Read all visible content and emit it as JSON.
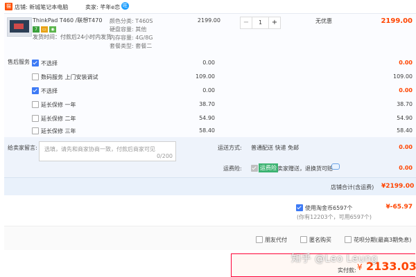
{
  "shop": {
    "icon": "tmall-icon",
    "icon_text": "猫",
    "label": "店铺: 新城笔记本电脑",
    "seller": "卖家: 芊年e恋",
    "ww_icon": "wangwang-icon",
    "ww_text": "旺"
  },
  "item": {
    "title": "ThinkPad T460 /联想T4705...",
    "badges": [
      {
        "text": "7",
        "color": "#3ca13c"
      },
      {
        "text": "▭",
        "color": "#e8a317"
      },
      {
        "text": "◉",
        "color": "#5ab44a"
      }
    ],
    "ship_note": "发货时间：付款后24小时内发货",
    "specs": [
      "颜色分类: T460S",
      "硬盘容量: 其他",
      "内存容量: 4G/8G",
      "套餐类型: 套餐二"
    ],
    "unit_price": "2199.00",
    "qty_minus": "−",
    "qty_value": "1",
    "qty_plus": "+",
    "discount": "无优惠",
    "subtotal": "2199.00"
  },
  "services": {
    "label": "售后服务",
    "rows": [
      {
        "text": "不选择",
        "checked": true,
        "price": "0.00",
        "total": "0.00"
      },
      {
        "text": "数码服务 上门安装调试",
        "checked": false,
        "price": "109.00",
        "total": "109.00"
      },
      {
        "text": "不选择",
        "checked": true,
        "price": "0.00",
        "total": "0.00"
      },
      {
        "text": "延长保修 一年",
        "checked": false,
        "price": "38.70",
        "total": "38.70"
      },
      {
        "text": "延长保修 二年",
        "checked": false,
        "price": "54.90",
        "total": "54.90"
      },
      {
        "text": "延长保修 三年",
        "checked": false,
        "price": "58.40",
        "total": "58.40"
      }
    ]
  },
  "message": {
    "label": "给卖家留言:",
    "placeholder": "选填，请先和商家协商一致，付款后商家可见",
    "counter": "0/200"
  },
  "delivery": {
    "label": "运送方式:",
    "value": "普通配送 快递 免邮",
    "fee": "0.00"
  },
  "insurance": {
    "label": "运费险:",
    "tag": "运费险",
    "text": "卖家赠送，退换货可赔",
    "fee": "0.00",
    "chat_icon": "chat-bubble-icon"
  },
  "shop_total": {
    "label": "店铺合计(含运费)",
    "value": "¥2199.00"
  },
  "coins": {
    "label": "使用淘金币6597个",
    "sub": "(你有12203个，可用6597个)",
    "value": "¥-65.97"
  },
  "options": [
    {
      "text": "朋友代付"
    },
    {
      "text": "匿名购买"
    },
    {
      "text": "花呗分期(最高3期免息)"
    }
  ],
  "pay": {
    "label": "实付款:",
    "currency": "¥",
    "amount": "2133.03"
  },
  "watermark": "知乎 @Leo Leung"
}
